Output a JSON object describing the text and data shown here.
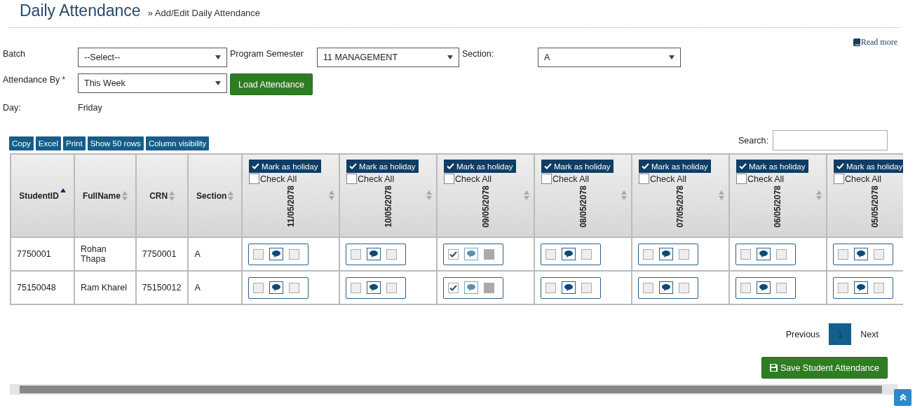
{
  "page": {
    "title": "Daily Attendance",
    "breadcrumb_separator": "»",
    "breadcrumb": "Add/Edit Daily Attendance",
    "read_more": "Read more"
  },
  "filters": {
    "batch": {
      "label": "Batch",
      "value": "--Select--"
    },
    "program_semester": {
      "label": "Program Semester",
      "value": "11 MANAGEMENT"
    },
    "section": {
      "label": "Section:",
      "value": "A"
    },
    "attendance_by": {
      "label": "Attendance By",
      "required_mark": "*",
      "value": "This Week"
    },
    "load_button": "Load Attendance",
    "day": {
      "label": "Day:",
      "value": "Friday"
    }
  },
  "export_buttons": [
    "Copy",
    "Excel",
    "Print",
    "Show 50 rows",
    "Column visibility"
  ],
  "search": {
    "label": "Search:"
  },
  "table": {
    "columns": [
      {
        "label": "StudentID",
        "sorted": true
      },
      {
        "label": "FullName",
        "sorted": false
      },
      {
        "label": "CRN",
        "sorted": false
      },
      {
        "label": "Section",
        "sorted": false
      }
    ],
    "dates": [
      {
        "label": "11/05/2078",
        "holiday_button": "Mark as holiday",
        "check_all": "Check All",
        "check_all_checked": false
      },
      {
        "label": "10/05/2078",
        "holiday_button": "Mark as holiday",
        "check_all": "Check All",
        "check_all_checked": false
      },
      {
        "label": "09/05/2078",
        "holiday_button": "Mark as holiday",
        "check_all": "Check All",
        "check_all_checked": false
      },
      {
        "label": "08/05/2078",
        "holiday_button": "Mark as holiday",
        "check_all": "Check All",
        "check_all_checked": false
      },
      {
        "label": "07/05/2078",
        "holiday_button": "Mark as holiday",
        "check_all": "Check All",
        "check_all_checked": false
      },
      {
        "label": "06/05/2078",
        "holiday_button": "Mark as holiday",
        "check_all": "Check All",
        "check_all_checked": false
      },
      {
        "label": "05/05/2078",
        "holiday_button": "Mark as holiday",
        "check_all": "Check All",
        "check_all_checked": false
      }
    ],
    "rows": [
      {
        "cells": [
          "7750001",
          "Rohan Thapa",
          "7750001",
          "A"
        ],
        "attendance": [
          {
            "present": false,
            "leave": false,
            "leave_disabled": false
          },
          {
            "present": false,
            "leave": false,
            "leave_disabled": false
          },
          {
            "present": true,
            "leave": false,
            "leave_disabled": true
          },
          {
            "present": false,
            "leave": false,
            "leave_disabled": false
          },
          {
            "present": false,
            "leave": false,
            "leave_disabled": false
          },
          {
            "present": false,
            "leave": false,
            "leave_disabled": false
          },
          {
            "present": false,
            "leave": false,
            "leave_disabled": false
          }
        ]
      },
      {
        "cells": [
          "75150048",
          "Ram Kharel",
          "75150012",
          "A"
        ],
        "attendance": [
          {
            "present": false,
            "leave": false,
            "leave_disabled": false
          },
          {
            "present": false,
            "leave": false,
            "leave_disabled": false
          },
          {
            "present": true,
            "leave": false,
            "leave_disabled": true
          },
          {
            "present": false,
            "leave": false,
            "leave_disabled": false
          },
          {
            "present": false,
            "leave": false,
            "leave_disabled": false
          },
          {
            "present": false,
            "leave": false,
            "leave_disabled": false
          },
          {
            "present": false,
            "leave": false,
            "leave_disabled": false
          }
        ]
      }
    ]
  },
  "pagination": {
    "previous": "Previous",
    "pages": [
      {
        "label": "1",
        "selected": true
      }
    ],
    "next": "Next"
  },
  "save_button": "Save Student Attendance"
}
